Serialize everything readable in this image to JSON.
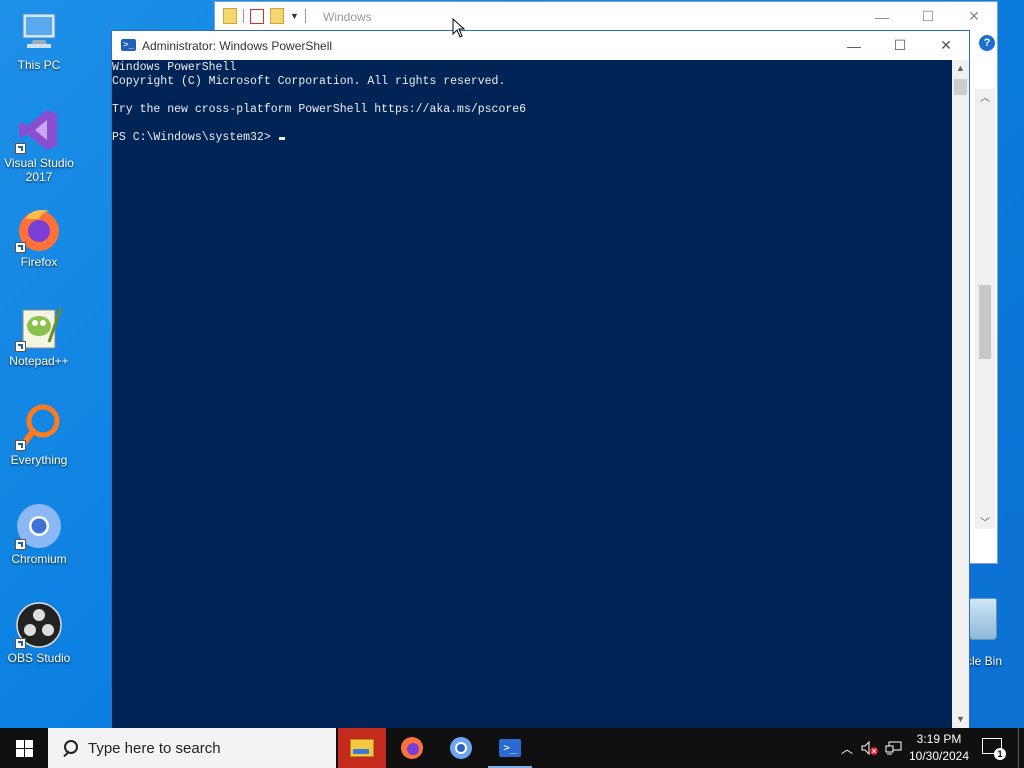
{
  "desktop": {
    "icons": [
      {
        "label": "This PC",
        "icon": "this-pc-icon"
      },
      {
        "label": "Visual Studio 2017",
        "icon": "visual-studio-icon"
      },
      {
        "label": "Firefox",
        "icon": "firefox-icon"
      },
      {
        "label": "Notepad++",
        "icon": "notepadpp-icon"
      },
      {
        "label": "Everything",
        "icon": "everything-icon"
      },
      {
        "label": "Chromium",
        "icon": "chromium-icon"
      },
      {
        "label": "OBS Studio",
        "icon": "obs-icon"
      }
    ],
    "recycle_bin_label": "cle Bin"
  },
  "explorer": {
    "title": "Windows",
    "help": "?"
  },
  "powershell": {
    "title": "Administrator: Windows PowerShell",
    "lines": [
      "Windows PowerShell",
      "Copyright (C) Microsoft Corporation. All rights reserved.",
      "",
      "Try the new cross-platform PowerShell https://aka.ms/pscore6",
      "",
      "PS C:\\Windows\\system32> "
    ]
  },
  "taskbar": {
    "search_placeholder": "Type here to search",
    "apps": [
      "File Explorer",
      "Firefox",
      "Chromium",
      "Windows PowerShell"
    ],
    "time": "3:19 PM",
    "date": "10/30/2024",
    "notification_count": "1"
  },
  "colors": {
    "console_bg": "#012456",
    "console_fg": "#eeedf0",
    "desktop_bg": "#0a7fe0",
    "taskbar_bg": "#101010"
  }
}
